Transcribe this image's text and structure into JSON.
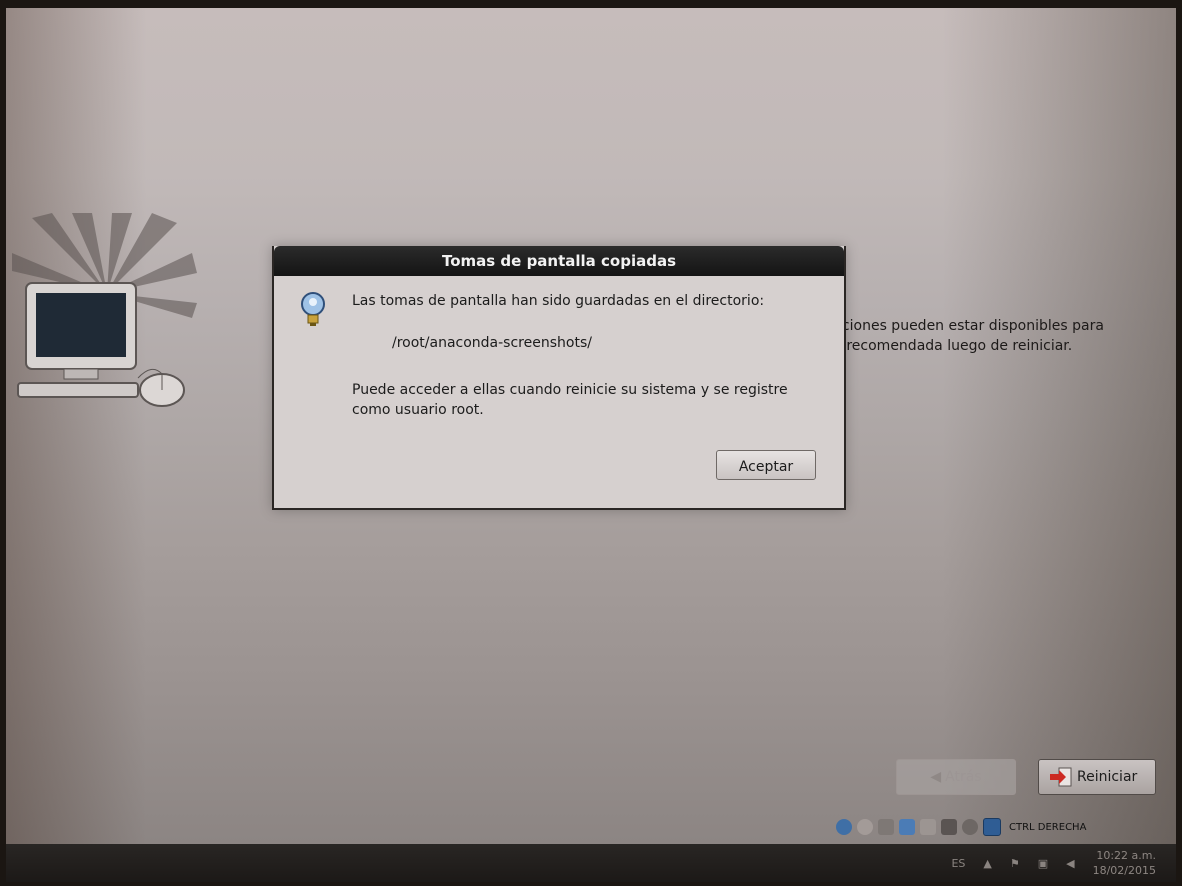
{
  "dialog": {
    "title": "Tomas de pantalla copiadas",
    "message": "Las tomas de pantalla han sido guardadas en el directorio:",
    "path": "/root/anaconda-screenshots/",
    "note": "Puede acceder a ellas cuando reinicie su sistema y se registre como usuario root.",
    "ok_label": "Aceptar",
    "icon": "info-lightbulb-icon"
  },
  "background": {
    "line1": "zaciones pueden estar disponibles para",
    "line2": "es recomendada luego de reiniciar."
  },
  "nav": {
    "back_label": "Atrás",
    "reboot_label": "Reiniciar"
  },
  "vbox": {
    "host_key": "CTRL DERECHA"
  },
  "taskbar": {
    "lang": "ES",
    "time": "10:22 a.m.",
    "date": "18/02/2015"
  }
}
